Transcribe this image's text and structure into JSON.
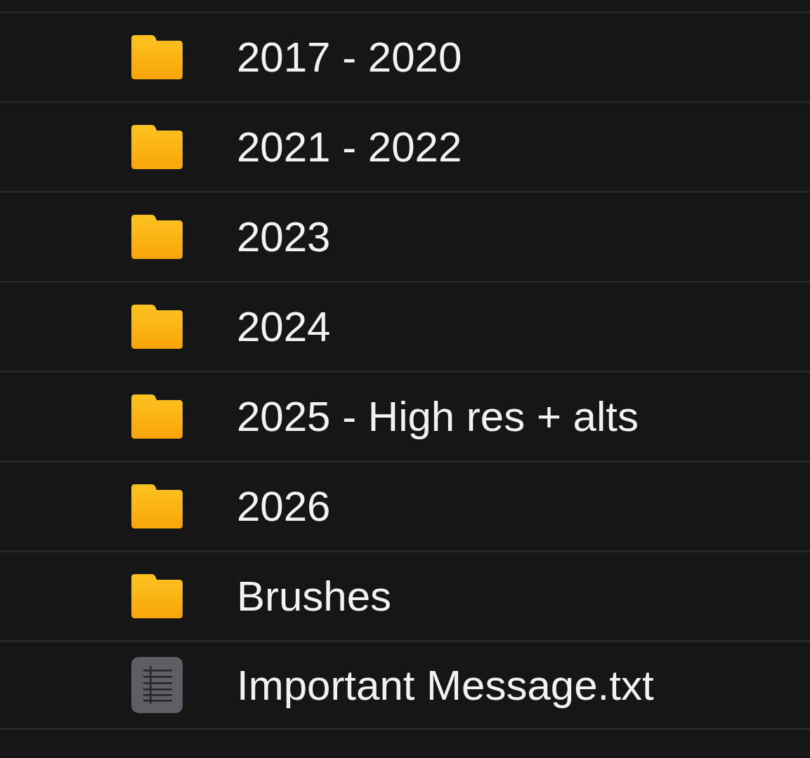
{
  "items": [
    {
      "kind": "folder",
      "name": "2017 - 2020"
    },
    {
      "kind": "folder",
      "name": "2021 - 2022"
    },
    {
      "kind": "folder",
      "name": "2023"
    },
    {
      "kind": "folder",
      "name": "2024"
    },
    {
      "kind": "folder",
      "name": "2025 - High res + alts"
    },
    {
      "kind": "folder",
      "name": "2026"
    },
    {
      "kind": "folder",
      "name": "Brushes"
    },
    {
      "kind": "text-file",
      "name": "Important Message.txt"
    }
  ]
}
